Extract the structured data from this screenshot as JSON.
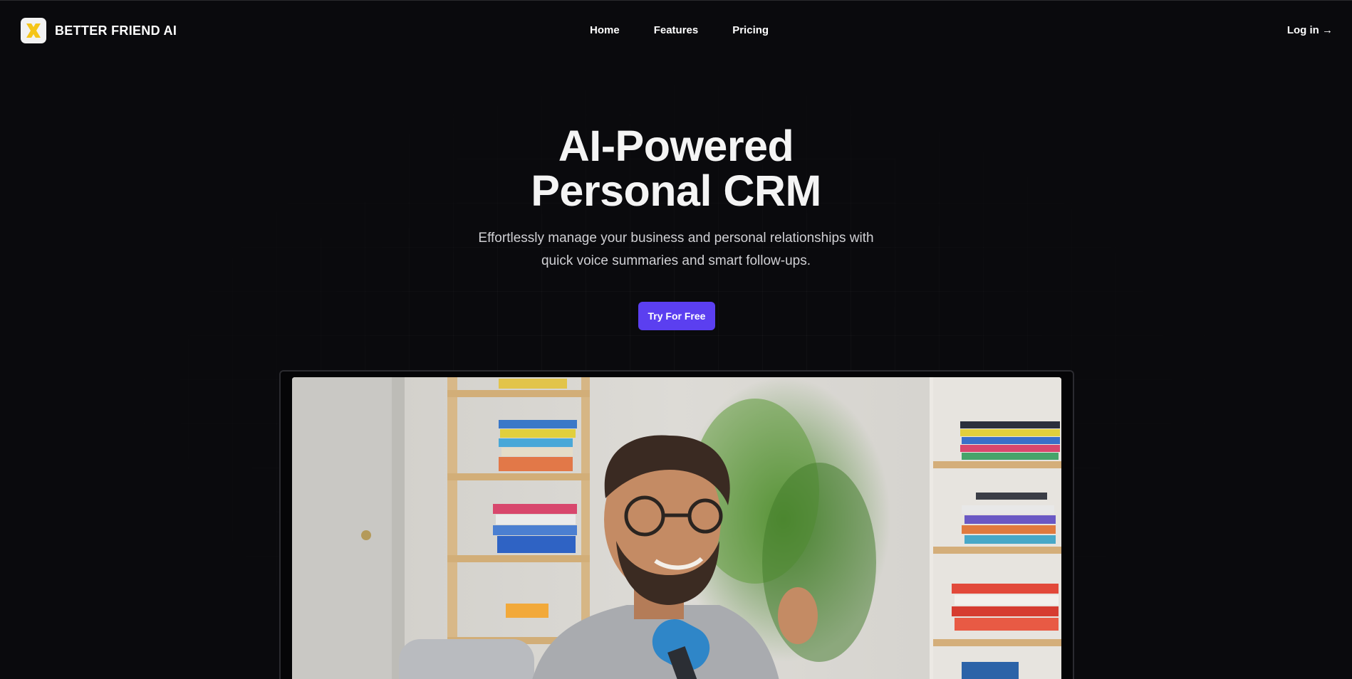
{
  "header": {
    "brand_name": "BETTER FRIEND AI",
    "logo_icon": "x-logo-icon",
    "nav": [
      {
        "label": "Home"
      },
      {
        "label": "Features"
      },
      {
        "label": "Pricing"
      }
    ],
    "login_label": "Log in →"
  },
  "hero": {
    "title_line1": "AI-Powered",
    "title_line2": "Personal CRM",
    "subtitle_line1": "Effortlessly manage your business and personal relationships with",
    "subtitle_line2": "quick voice summaries and smart follow-ups.",
    "cta_label": "Try For Free"
  },
  "colors": {
    "background": "#0a0a0d",
    "accent": "#5b3ff0",
    "logo_yellow": "#f5c518"
  },
  "media": {
    "video_icon": "video-thumbnail-image"
  }
}
